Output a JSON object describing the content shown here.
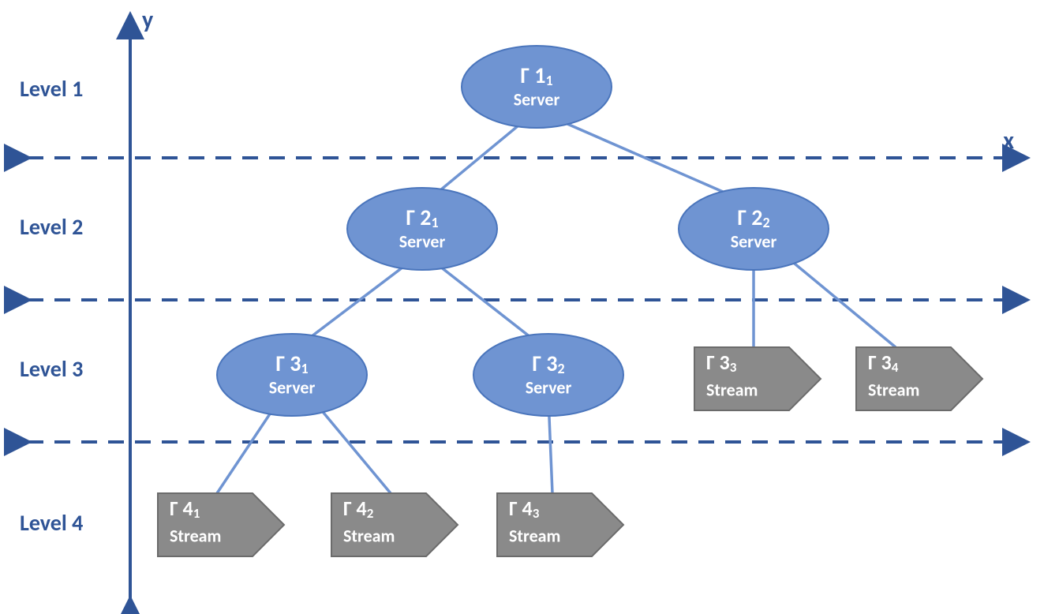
{
  "axes": {
    "x": "x",
    "y": "y"
  },
  "levels": [
    {
      "label": "Level 1"
    },
    {
      "label": "Level 2"
    },
    {
      "label": "Level 3"
    },
    {
      "label": "Level 4"
    }
  ],
  "nodes": {
    "n1_1": {
      "gamma": "Γ 1",
      "sub": "1",
      "type": "Server"
    },
    "n2_1": {
      "gamma": "Γ 2",
      "sub": "1",
      "type": "Server"
    },
    "n2_2": {
      "gamma": "Γ 2",
      "sub": "2",
      "type": "Server"
    },
    "n3_1": {
      "gamma": "Γ 3",
      "sub": "1",
      "type": "Server"
    },
    "n3_2": {
      "gamma": "Γ 3",
      "sub": "2",
      "type": "Server"
    },
    "n3_3": {
      "gamma": "Γ 3",
      "sub": "3",
      "type": "Stream"
    },
    "n3_4": {
      "gamma": "Γ 3",
      "sub": "4",
      "type": "Stream"
    },
    "n4_1": {
      "gamma": "Γ 4",
      "sub": "1",
      "type": "Stream"
    },
    "n4_2": {
      "gamma": "Γ 4",
      "sub": "2",
      "type": "Stream"
    },
    "n4_3": {
      "gamma": "Γ 4",
      "sub": "3",
      "type": "Stream"
    }
  },
  "edges": [
    [
      "n1_1",
      "n2_1"
    ],
    [
      "n1_1",
      "n2_2"
    ],
    [
      "n2_1",
      "n3_1"
    ],
    [
      "n2_1",
      "n3_2"
    ],
    [
      "n2_2",
      "n3_3"
    ],
    [
      "n2_2",
      "n3_4"
    ],
    [
      "n3_1",
      "n4_1"
    ],
    [
      "n3_1",
      "n4_2"
    ],
    [
      "n3_2",
      "n4_3"
    ]
  ],
  "colors": {
    "axis": "#2f5496",
    "server_fill": "#6f94d2",
    "server_stroke": "#4a75bc",
    "stream_fill": "#8a8a8a",
    "stream_stroke": "#6b6b6b"
  }
}
